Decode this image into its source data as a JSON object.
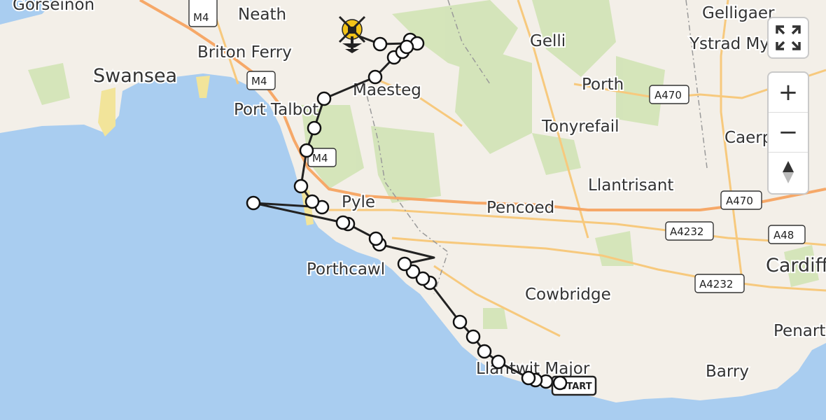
{
  "map": {
    "places": [
      {
        "name": "Gorseinon",
        "kind": "town"
      },
      {
        "name": "Neath",
        "kind": "town"
      },
      {
        "name": "Briton Ferry",
        "kind": "town"
      },
      {
        "name": "Swansea",
        "kind": "city"
      },
      {
        "name": "Port Talbot",
        "kind": "town"
      },
      {
        "name": "Maesteg",
        "kind": "town"
      },
      {
        "name": "Gelli",
        "kind": "town"
      },
      {
        "name": "Gelligaer",
        "kind": "town"
      },
      {
        "name": "Ystrad Mynach",
        "kind": "town"
      },
      {
        "name": "Porth",
        "kind": "town"
      },
      {
        "name": "Tonyrefail",
        "kind": "town"
      },
      {
        "name": "Caerphilly",
        "kind": "town"
      },
      {
        "name": "Pyle",
        "kind": "town"
      },
      {
        "name": "Pencoed",
        "kind": "town"
      },
      {
        "name": "Llantrisant",
        "kind": "town"
      },
      {
        "name": "Porthcawl",
        "kind": "town"
      },
      {
        "name": "Cowbridge",
        "kind": "town"
      },
      {
        "name": "Llantwit Major",
        "kind": "town"
      },
      {
        "name": "Barry",
        "kind": "town"
      },
      {
        "name": "Penarth",
        "kind": "town"
      },
      {
        "name": "Cardiff",
        "kind": "city"
      }
    ],
    "roads": [
      {
        "ref": "M4"
      },
      {
        "ref": "M4"
      },
      {
        "ref": "M4"
      },
      {
        "ref": "A470"
      },
      {
        "ref": "A470"
      },
      {
        "ref": "A4232"
      },
      {
        "ref": "A4232"
      },
      {
        "ref": "A48"
      }
    ],
    "colors": {
      "sea": "#a9cdf0",
      "land": "#f3efe8",
      "forest": "#cfe3b2",
      "motorway": "#f6a868",
      "primary": "#f7c97d",
      "route": "#222222",
      "beach": "#f2e49a"
    }
  },
  "route": {
    "start_label": "START",
    "end_icon": "helicopter-landed-icon",
    "waypoint_icon": "circle-marker"
  },
  "controls": {
    "fullscreen_icon": "fullscreen-icon",
    "zoom_in": "+",
    "zoom_out": "−",
    "reset_bearing_icon": "compass-icon"
  }
}
